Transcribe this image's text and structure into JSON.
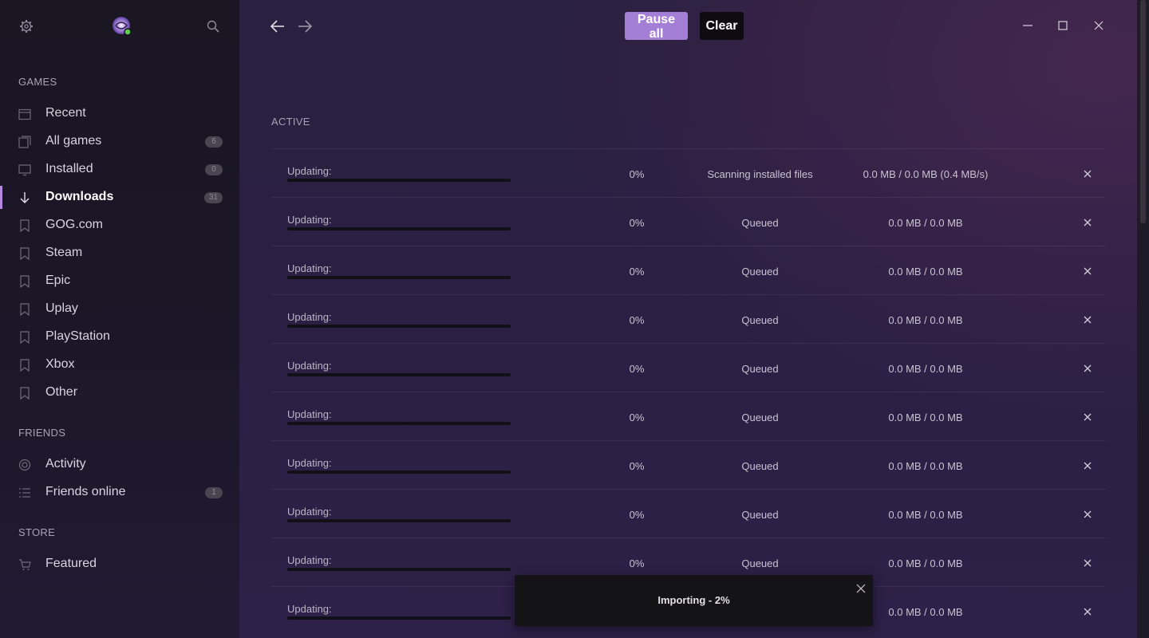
{
  "sidebar": {
    "sections": {
      "games": "GAMES",
      "friends": "FRIENDS",
      "store": "STORE"
    },
    "games": [
      {
        "label": "Recent",
        "icon": "calendar-icon"
      },
      {
        "label": "All games",
        "icon": "library-icon",
        "badge": "6"
      },
      {
        "label": "Installed",
        "icon": "monitor-icon",
        "badge": "0"
      },
      {
        "label": "Downloads",
        "icon": "download-icon",
        "badge": "31",
        "active": true
      },
      {
        "label": "GOG.com",
        "icon": "bookmark-icon"
      },
      {
        "label": "Steam",
        "icon": "bookmark-icon"
      },
      {
        "label": "Epic",
        "icon": "bookmark-icon"
      },
      {
        "label": "Uplay",
        "icon": "bookmark-icon"
      },
      {
        "label": "PlayStation",
        "icon": "bookmark-icon"
      },
      {
        "label": "Xbox",
        "icon": "bookmark-icon"
      },
      {
        "label": "Other",
        "icon": "bookmark-icon"
      }
    ],
    "friends": [
      {
        "label": "Activity",
        "icon": "activity-icon"
      },
      {
        "label": "Friends online",
        "icon": "list-icon",
        "badge": "1"
      }
    ],
    "store": [
      {
        "label": "Featured",
        "icon": "cart-icon"
      }
    ]
  },
  "toolbar": {
    "pause_all": "Pause all",
    "clear": "Clear"
  },
  "section_title": "ACTIVE",
  "downloads": [
    {
      "name": "Updating:",
      "percent": "0%",
      "progress": 0,
      "status": "Scanning installed files",
      "size": "0.0 MB / 0.0 MB (0.4 MB/s)"
    },
    {
      "name": "Updating:",
      "percent": "0%",
      "progress": 0,
      "status": "Queued",
      "size": "0.0 MB / 0.0 MB"
    },
    {
      "name": "Updating:",
      "percent": "0%",
      "progress": 0,
      "status": "Queued",
      "size": "0.0 MB / 0.0 MB"
    },
    {
      "name": "Updating:",
      "percent": "0%",
      "progress": 0,
      "status": "Queued",
      "size": "0.0 MB / 0.0 MB"
    },
    {
      "name": "Updating:",
      "percent": "0%",
      "progress": 0,
      "status": "Queued",
      "size": "0.0 MB / 0.0 MB"
    },
    {
      "name": "Updating:",
      "percent": "0%",
      "progress": 0,
      "status": "Queued",
      "size": "0.0 MB / 0.0 MB"
    },
    {
      "name": "Updating:",
      "percent": "0%",
      "progress": 0,
      "status": "Queued",
      "size": "0.0 MB / 0.0 MB"
    },
    {
      "name": "Updating:",
      "percent": "0%",
      "progress": 0,
      "status": "Queued",
      "size": "0.0 MB / 0.0 MB"
    },
    {
      "name": "Updating:",
      "percent": "0%",
      "progress": 0,
      "status": "Queued",
      "size": "0.0 MB / 0.0 MB"
    },
    {
      "name": "Updating:",
      "percent": "",
      "progress": 0,
      "status": "",
      "size": "0.0 MB / 0.0 MB"
    }
  ],
  "toast": {
    "message": "Importing - 2%",
    "progress_percent": 2
  },
  "colors": {
    "accent": "#a57fd6",
    "active_indicator": "#b389dd",
    "clear_button": "#0e0c11"
  }
}
